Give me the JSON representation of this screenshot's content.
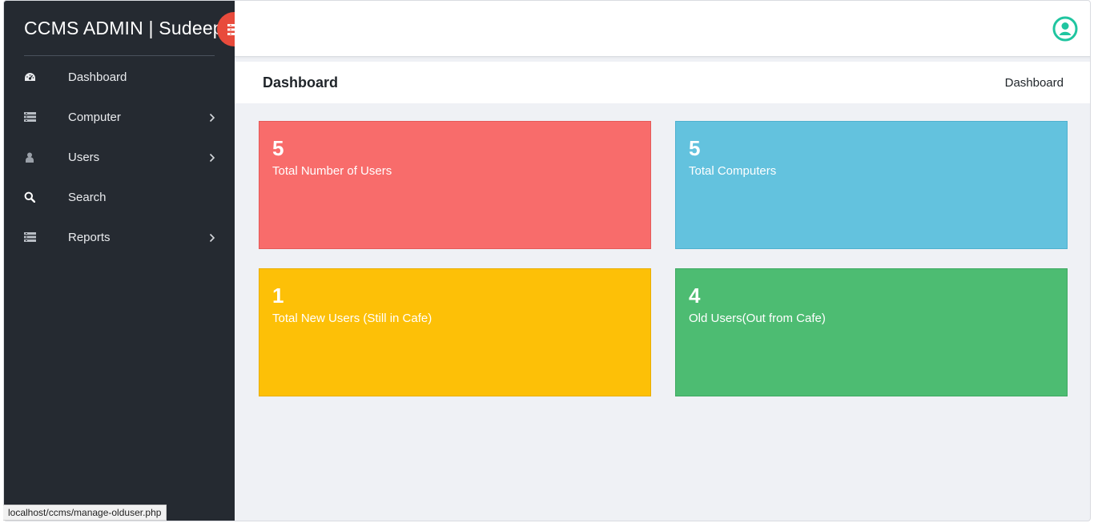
{
  "sidebar": {
    "brand": "CCMS ADMIN | Sudeep",
    "items": [
      {
        "label": "Dashboard",
        "icon": "dashboard-gauge-icon",
        "has_submenu": false
      },
      {
        "label": "Computer",
        "icon": "server-icon",
        "has_submenu": true
      },
      {
        "label": "Users",
        "icon": "user-icon",
        "has_submenu": true
      },
      {
        "label": "Search",
        "icon": "search-icon",
        "has_submenu": false
      },
      {
        "label": "Reports",
        "icon": "server-icon",
        "has_submenu": true
      }
    ]
  },
  "header": {
    "page_title": "Dashboard",
    "breadcrumb": "Dashboard"
  },
  "cards": [
    {
      "value": "5",
      "label": "Total Number of Users",
      "color": "#f86c6b"
    },
    {
      "value": "5",
      "label": "Total Computers",
      "color": "#63c2de"
    },
    {
      "value": "1",
      "label": "Total New Users (Still in Cafe)",
      "color": "#fdc007"
    },
    {
      "value": "4",
      "label": "Old Users(Out from Cafe)",
      "color": "#4dbc72"
    }
  ],
  "status_bar": {
    "url": "localhost/ccms/manage-olduser.php"
  },
  "colors": {
    "sidebar_bg": "#252a31",
    "accent_toggle": "#e84b3c",
    "user_icon": "#20c5a0",
    "content_bg": "#eff1f5"
  }
}
